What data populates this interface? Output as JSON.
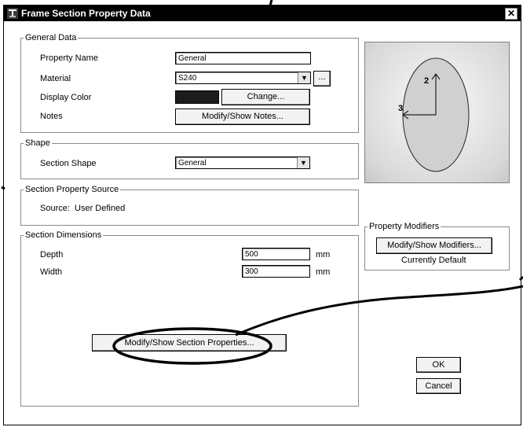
{
  "window": {
    "title": "Frame Section Property Data",
    "close_glyph": "✕"
  },
  "general": {
    "legend": "General Data",
    "property_name_label": "Property Name",
    "property_name_value": "General",
    "material_label": "Material",
    "material_value": "S240",
    "material_more": "...",
    "display_color_label": "Display Color",
    "change_button": "Change...",
    "notes_label": "Notes",
    "notes_button": "Modify/Show Notes..."
  },
  "shape": {
    "legend": "Shape",
    "section_shape_label": "Section Shape",
    "section_shape_value": "General"
  },
  "source": {
    "legend": "Section Property Source",
    "source_text": "Source:  User Defined"
  },
  "dimensions": {
    "legend": "Section Dimensions",
    "depth_label": "Depth",
    "depth_value": "500",
    "depth_unit": "mm",
    "width_label": "Width",
    "width_value": "300",
    "width_unit": "mm",
    "section_props_button": "Modify/Show Section Properties..."
  },
  "preview": {
    "axis2_label": "2",
    "axis3_label": "3"
  },
  "modifiers": {
    "legend": "Property Modifiers",
    "button": "Modify/Show Modifiers...",
    "status": "Currently Default"
  },
  "actions": {
    "ok": "OK",
    "cancel": "Cancel"
  },
  "colors": {
    "display_color": "#1c1c1c",
    "titlebar": "#000000"
  },
  "icons": {
    "title_icon": "app-icon",
    "combo_arrow": "▼"
  }
}
